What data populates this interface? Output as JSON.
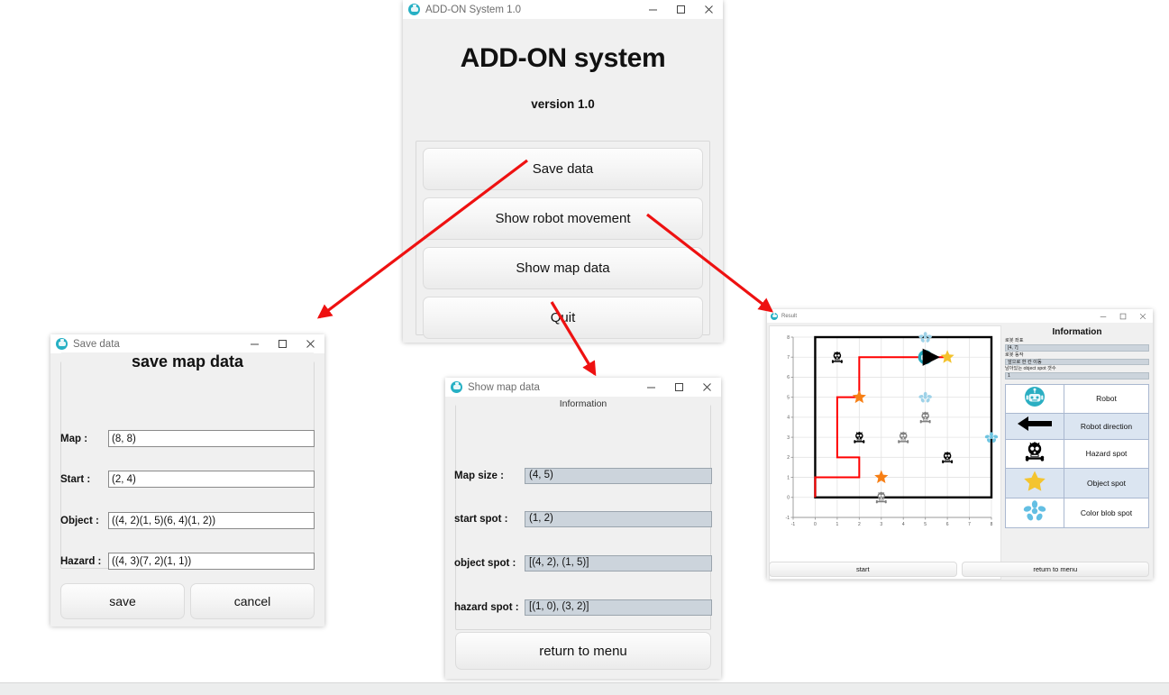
{
  "main_window": {
    "titlebar": {
      "title": "ADD-ON System 1.0",
      "minimize": "—",
      "maximize": "☐",
      "close": "✕"
    },
    "app_title": "ADD-ON system",
    "version": "version 1.0",
    "buttons": [
      {
        "label": "Save data"
      },
      {
        "label": "Show robot movement"
      },
      {
        "label": "Show map data"
      },
      {
        "label": "Quit"
      }
    ]
  },
  "save_window": {
    "titlebar": {
      "title": "Save data",
      "minimize": "—",
      "maximize": "☐",
      "close": "✕"
    },
    "heading": "save map data",
    "fields": [
      {
        "label": "Map :",
        "value": "(8, 8)"
      },
      {
        "label": "Start :",
        "value": "(2, 4)"
      },
      {
        "label": "Object :",
        "value": "((4, 2)(1, 5)(6, 4)(1, 2))"
      },
      {
        "label": "Hazard :",
        "value": "((4, 3)(7, 2)(1, 1))"
      }
    ],
    "save_label": "save",
    "cancel_label": "cancel"
  },
  "mapdata_window": {
    "titlebar": {
      "title": "Show map data",
      "minimize": "—",
      "maximize": "☐",
      "close": "✕"
    },
    "group_title": "Information",
    "fields": [
      {
        "label": "Map size :",
        "value": "(4, 5)"
      },
      {
        "label": "start spot :",
        "value": "(1, 2)"
      },
      {
        "label": "object spot :",
        "value": "[(4, 2), (1, 5)]"
      },
      {
        "label": "hazard spot :",
        "value": "[(1, 0), (3, 2)]"
      }
    ],
    "return_label": "return to menu"
  },
  "result_window": {
    "titlebar": {
      "title": "Result",
      "minimize": "—",
      "maximize": "☐",
      "close": "✕"
    },
    "info_title": "Information",
    "info_fields": [
      {
        "key": "로봇 좌표",
        "value": "[4, 7]"
      },
      {
        "key": "로봇 동작",
        "value": "앞으로 한 칸 이동"
      },
      {
        "key": "남아있는 object spot 갯수",
        "value": "1"
      }
    ],
    "legend": [
      {
        "icon": "robot-icon",
        "label": "Robot"
      },
      {
        "icon": "arrow-left-icon",
        "label": "Robot direction"
      },
      {
        "icon": "skull-icon",
        "label": "Hazard spot"
      },
      {
        "icon": "star-icon",
        "label": "Object spot"
      },
      {
        "icon": "color-blob-icon",
        "label": "Color blob spot"
      }
    ],
    "start_label": "start",
    "return_label": "return to menu"
  },
  "chart_data": {
    "type": "scatter",
    "title": "",
    "xlabel": "",
    "ylabel": "",
    "xlim": [
      -1,
      8
    ],
    "ylim": [
      -1,
      8
    ],
    "xticks": [
      -1,
      0,
      1,
      2,
      3,
      4,
      5,
      6,
      7,
      8
    ],
    "yticks": [
      -1,
      0,
      1,
      2,
      3,
      4,
      5,
      6,
      7,
      8
    ],
    "grid": true,
    "boundary": {
      "x0": 0,
      "y0": 0,
      "x1": 8,
      "y1": 8,
      "color": "#000000"
    },
    "robot": {
      "x": 5,
      "y": 7,
      "direction": "right",
      "color": "#24a8bd"
    },
    "path": {
      "color": "#ff0000",
      "points": [
        [
          0,
          0
        ],
        [
          0,
          1
        ],
        [
          2,
          1
        ],
        [
          2,
          2
        ],
        [
          1,
          2
        ],
        [
          1,
          5
        ],
        [
          2,
          5
        ],
        [
          2,
          7
        ],
        [
          5,
          7
        ],
        [
          6,
          7
        ]
      ]
    },
    "object_spots": [
      {
        "x": 6,
        "y": 7,
        "color": "#f3c22c"
      },
      {
        "x": 2,
        "y": 5,
        "color": "#f77f15"
      },
      {
        "x": 3,
        "y": 1,
        "color": "#f77f15"
      }
    ],
    "hazard_spots": [
      {
        "x": 1,
        "y": 7,
        "color": "#000000"
      },
      {
        "x": 2,
        "y": 3,
        "color": "#000000"
      },
      {
        "x": 6,
        "y": 2,
        "color": "#000000"
      },
      {
        "x": 5,
        "y": 4,
        "color": "#808080"
      },
      {
        "x": 4,
        "y": 3,
        "color": "#808080"
      },
      {
        "x": 3,
        "y": 0,
        "color": "#808080"
      }
    ],
    "color_blob_spots": [
      {
        "x": 5,
        "y": 8,
        "color": "#9ed2e8"
      },
      {
        "x": 5,
        "y": 5,
        "color": "#9ed2e8"
      },
      {
        "x": 8,
        "y": 3,
        "color": "#6fc4e0"
      }
    ]
  },
  "annotations": {
    "arrow_color": "#ee1111",
    "arrows": [
      {
        "name": "arrow-to-save-window"
      },
      {
        "name": "arrow-to-result-window"
      },
      {
        "name": "arrow-to-mapdata-window"
      }
    ]
  }
}
